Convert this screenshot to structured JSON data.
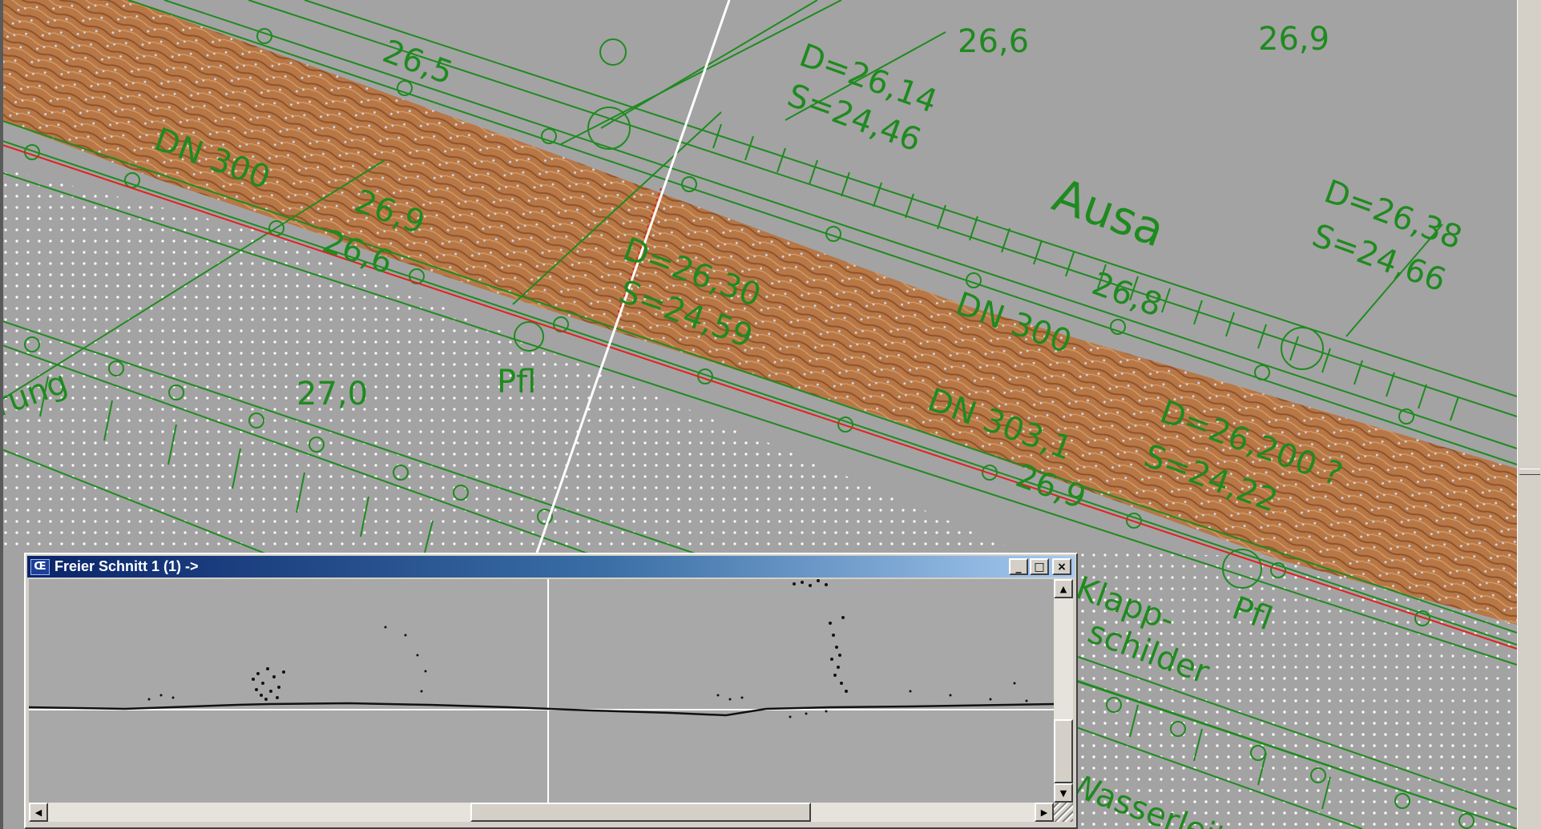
{
  "window": {
    "title": "Freier Schnitt 1 (1) ->",
    "icon": "app-logo-icon",
    "icon_glyph": "Œ",
    "buttons": {
      "minimize": {
        "icon": "minimize-icon",
        "glyph": "_"
      },
      "maximize": {
        "icon": "maximize-icon",
        "glyph": "□"
      },
      "close": {
        "icon": "close-icon",
        "glyph": "×"
      }
    },
    "scroll_glyphs": {
      "up": "▲",
      "down": "▼",
      "left": "◀",
      "right": "▶"
    }
  },
  "drawing": {
    "annotations": {
      "h1": "26,6",
      "h2": "26,9",
      "d1": "D=26,14",
      "s1": "S=24,46",
      "river": "Ausa",
      "d2": "D=26,38",
      "s2": "S=24,66",
      "dn1": "DN 300",
      "h3": "26,9",
      "h4": "26,6",
      "d3": "D=26,30",
      "s3": "S=24,59",
      "dn2": "DN 300",
      "h5": "26,8",
      "h6": "26,5",
      "h7": "27,0",
      "pfl1": "Pfl",
      "dn3": "DN 303,1",
      "d4": "D=26,200 ?",
      "s4": "S=24,22",
      "h8": "26,9",
      "pfl2": "Pfl",
      "rung": "rung",
      "klapp1": "Klapp-",
      "klapp2": "schilder",
      "wasser": "Wasserleitu"
    }
  },
  "colors": {
    "background": "#a3a3a3",
    "cad_green": "#1f8a1f",
    "river_brown": "#b8703a",
    "red_line": "#e0211c",
    "section_line": "#ffffff",
    "titlebar_start": "#0a246a",
    "titlebar_end": "#a6caf0"
  }
}
